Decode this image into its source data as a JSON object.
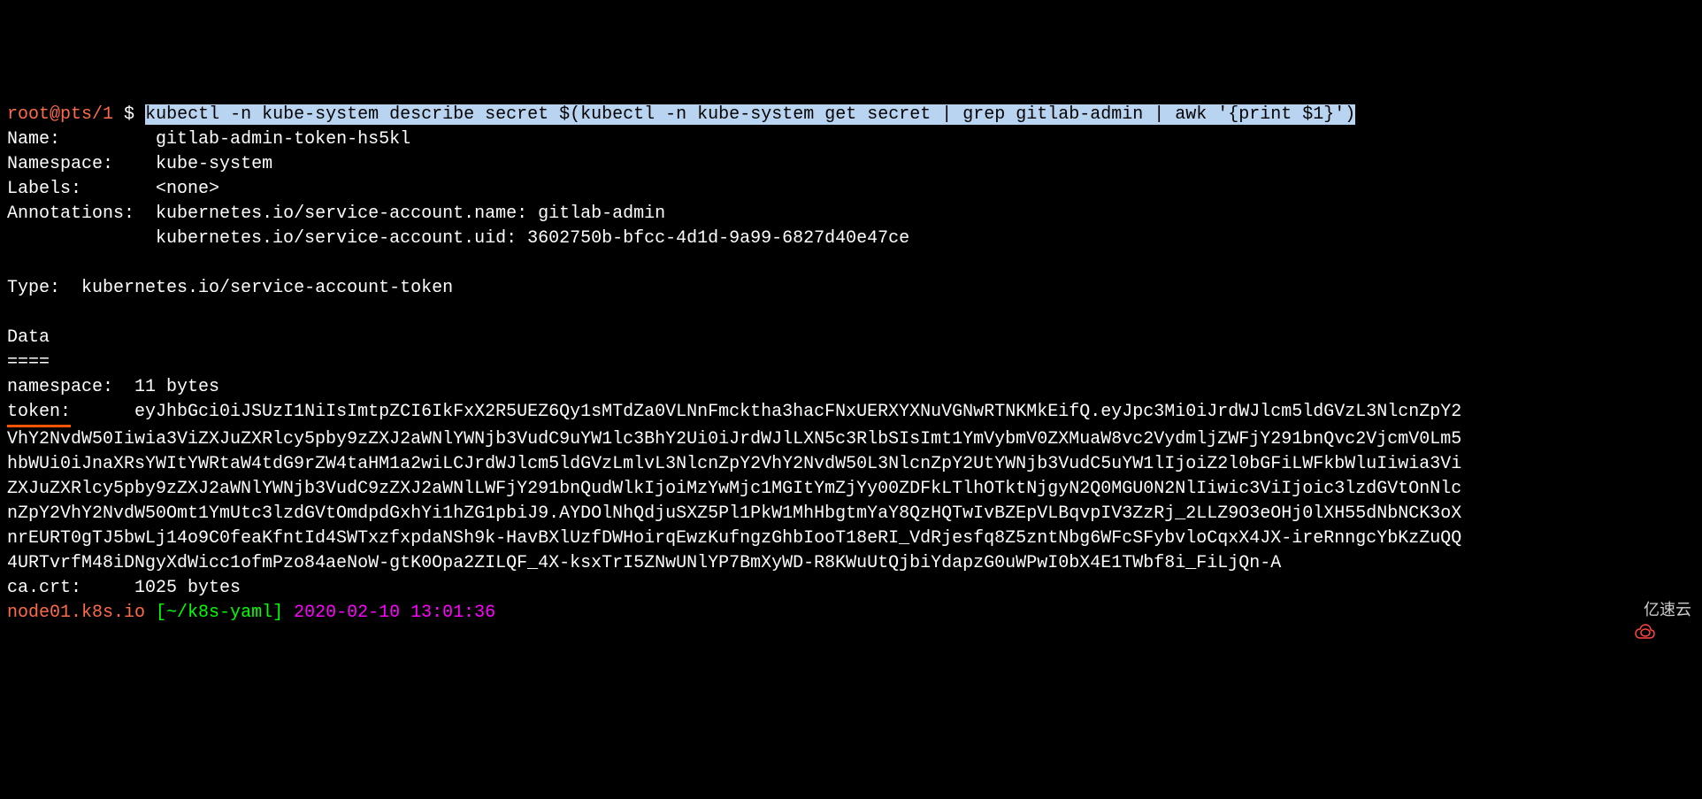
{
  "prompt": {
    "user_host": "root@pts/1",
    "dollar": "$",
    "command": "kubectl -n kube-system describe secret $(kubectl -n kube-system get secret | grep gitlab-admin | awk '{print $1}')"
  },
  "secret": {
    "name_label": "Name:",
    "name_value": "gitlab-admin-token-hs5kl",
    "namespace_label": "Namespace:",
    "namespace_value": "kube-system",
    "labels_label": "Labels:",
    "labels_value": "<none>",
    "annotations_label": "Annotations:",
    "annotations_line1": "kubernetes.io/service-account.name: gitlab-admin",
    "annotations_line2": "kubernetes.io/service-account.uid: 3602750b-bfcc-4d1d-9a99-6827d40e47ce",
    "type_label": "Type:",
    "type_value": "kubernetes.io/service-account-token",
    "data_header": "Data",
    "data_divider": "====",
    "ns_label": "namespace:",
    "ns_value": "11 bytes",
    "token_label": "token:",
    "token_value_first": "eyJhbGci0iJSUzI1NiIsImtpZCI6IkFxX2R5UEZ6Qy1sMTdZa0VLNnFmcktha3hacFNxUERXYXNuVGNwRTNKMkEifQ.eyJpc3Mi0iJrdWJlcm5ldGVzL3NlcnZpY2",
    "token_value_rest": "VhY2NvdW50Iiwia3ViZXJuZXRlcy5pby9zZXJ2aWNlYWNjb3VudC9uYW1lc3BhY2Ui0iJrdWJlLXN5c3RlbSIsImt1YmVybmV0ZXMuaW8vc2VydmljZWFjY291bnQvc2VjcmV0Lm5\nhbWUi0iJnaXRsYWItYWRtaW4tdG9rZW4taHM1a2wiLCJrdWJlcm5ldGVzLmlvL3NlcnZpY2VhY2NvdW50L3NlcnZpY2UtYWNjb3VudC5uYW1lIjoiZ2l0bGFiLWFkbWluIiwia3Vi\nZXJuZXRlcy5pby9zZXJ2aWNlYWNjb3VudC9zZXJ2aWNlLWFjY291bnQudWlkIjoiMzYwMjc1MGItYmZjYy00ZDFkLTlhOTktNjgyN2Q0MGU0N2NlIiwic3ViIjoic3lzdGVtOnNlc\nnZpY2VhY2NvdW50Omt1YmUtc3lzdGVtOmdpdGxhYi1hZG1pbiJ9.AYDOlNhQdjuSXZ5Pl1PkW1MhHbgtmYaY8QzHQTwIvBZEpVLBqvpIV3ZzRj_2LLZ9O3eOHj0lXH55dNbNCK3oX\nnrEURT0gTJ5bwLj14o9C0feaKfntId4SWTxzfxpdaNSh9k-HavBXlUzfDWHoirqEwzKufngzGhbIooT18eRI_VdRjesfq8Z5zntNbg6WFcSFybvloCqxX4JX-ireRnngcYbKzZuQQ\n4URTvrfM48iDNgyXdWicc1ofmPzo84aeNoW-gtK0Opa2ZILQF_4X-ksxTrI5ZNwUNlYP7BmXyWD-R8KWuUtQjbiYdapzG0uWPwI0bX4E1TWbf8i_FiLjQn-A",
    "cacrt_label": "ca.crt:",
    "cacrt_value": "1025 bytes"
  },
  "bottom_prompt": {
    "host": "node01.k8s.io",
    "path": "[~/k8s-yaml]",
    "timestamp": "2020-02-10 13:01:36"
  },
  "watermark": {
    "text": "亿速云"
  }
}
